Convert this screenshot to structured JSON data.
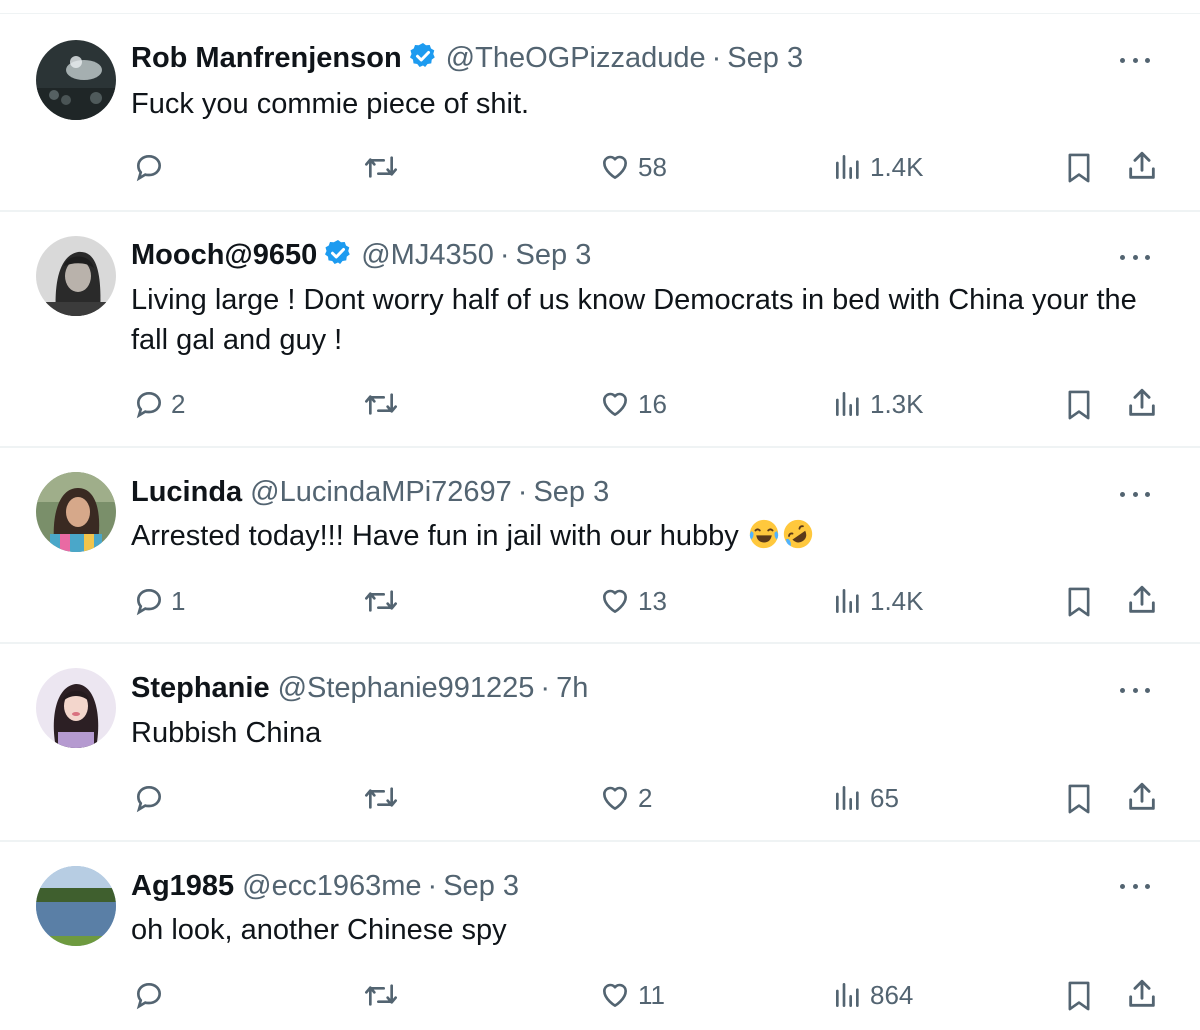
{
  "tweets": [
    {
      "name": "Rob Manfrenjenson",
      "verified": true,
      "handle": "@TheOGPizzadude",
      "separator": "·",
      "time": "Sep 3",
      "text": "Fuck you commie piece of shit.",
      "replies": "",
      "likes": "58",
      "views": "1.4K"
    },
    {
      "name": "Mooch@9650",
      "verified": true,
      "handle": "@MJ4350",
      "separator": "·",
      "time": "Sep 3",
      "text": "Living large ! Dont worry half of us know Democrats in bed with China your the fall gal and guy !",
      "replies": "2",
      "likes": "16",
      "views": "1.3K"
    },
    {
      "name": "Lucinda",
      "verified": false,
      "handle": "@LucindaMPi72697",
      "separator": "·",
      "time": "Sep 3",
      "text": "Arrested today!!! Have fun in jail with our hubby",
      "emojis": "😂🤣",
      "replies": "1",
      "likes": "13",
      "views": "1.4K"
    },
    {
      "name": "Stephanie",
      "verified": false,
      "handle": "@Stephanie991225",
      "separator": "·",
      "time": "7h",
      "text": "Rubbish China",
      "replies": "",
      "likes": "2",
      "views": "65"
    },
    {
      "name": "Ag1985",
      "verified": false,
      "handle": "@ecc1963me",
      "separator": "·",
      "time": "Sep 3",
      "text": "oh look, another Chinese spy",
      "replies": "",
      "likes": "11",
      "views": "864"
    }
  ],
  "colors": {
    "text": "#0f1419",
    "secondary": "#536471",
    "verified": "#1d9bf0",
    "divider": "#eff3f4"
  },
  "icons": {
    "reply": "reply-icon",
    "retweet": "retweet-icon",
    "like": "like-icon",
    "views": "views-icon",
    "bookmark": "bookmark-icon",
    "share": "share-icon",
    "more": "more-icon",
    "verified": "verified-badge-icon"
  }
}
